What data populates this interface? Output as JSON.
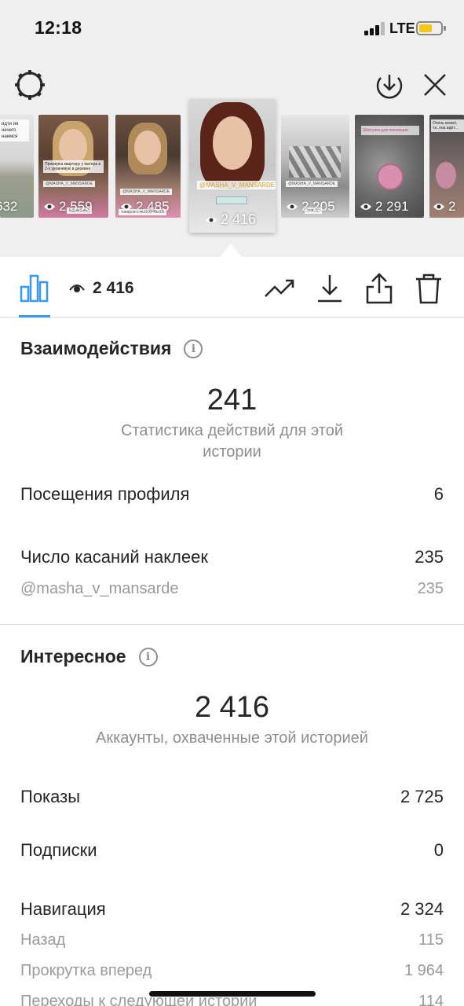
{
  "status_bar": {
    "time": "12:18",
    "network": "LTE"
  },
  "stories": [
    {
      "views": "632",
      "tag": "",
      "caption": "идти ия\nнечего\nнаемся"
    },
    {
      "views": "2 559",
      "tag": "@MASHA_V_MANSARDE",
      "caption": "Примерка квартиру у матера в 2-х уровневую в деревне",
      "extra": "Идеальная"
    },
    {
      "views": "2 485",
      "tag": "@MASHA_V_MANSARDE",
      "caption": "",
      "extra": "товаров с ALIEXPRESS"
    },
    {
      "views": "2 416",
      "tag": "@MASHA_V_MANSARDE",
      "caption": ""
    },
    {
      "views": "2 205",
      "tag": "@MASHA_V_MANSARDE",
      "caption": "",
      "extra": "плитки"
    },
    {
      "views": "2 291",
      "tag": "",
      "caption": "Шкатулка для коллекции"
    },
    {
      "views": "2",
      "tag": "",
      "caption": "Очень может, т.к. она идёт..."
    }
  ],
  "toolbar": {
    "views": "2 416"
  },
  "interactions": {
    "title": "Взаимодействия",
    "total": "241",
    "total_label": "Статистика действий для этой истории",
    "rows": [
      {
        "label": "Посещения профиля",
        "value": "6"
      },
      {
        "label": "Число касаний наклеек",
        "value": "235"
      }
    ],
    "sub_rows": [
      {
        "label": "@masha_v_mansarde",
        "value": "235"
      }
    ]
  },
  "discovery": {
    "title": "Интересное",
    "total": "2 416",
    "total_label": "Аккаунты, охваченные этой историей",
    "rows": [
      {
        "label": "Показы",
        "value": "2 725"
      },
      {
        "label": "Подписки",
        "value": "0"
      },
      {
        "label": "Навигация",
        "value": "2 324"
      }
    ],
    "nav_rows": [
      {
        "label": "Назад",
        "value": "115"
      },
      {
        "label": "Прокрутка вперед",
        "value": "1 964"
      },
      {
        "label": "Переходы к следующей истории",
        "value": "114"
      }
    ]
  },
  "colors": {
    "accent": "#3897f0",
    "text": "#262626",
    "muted": "#8e8e8e"
  }
}
